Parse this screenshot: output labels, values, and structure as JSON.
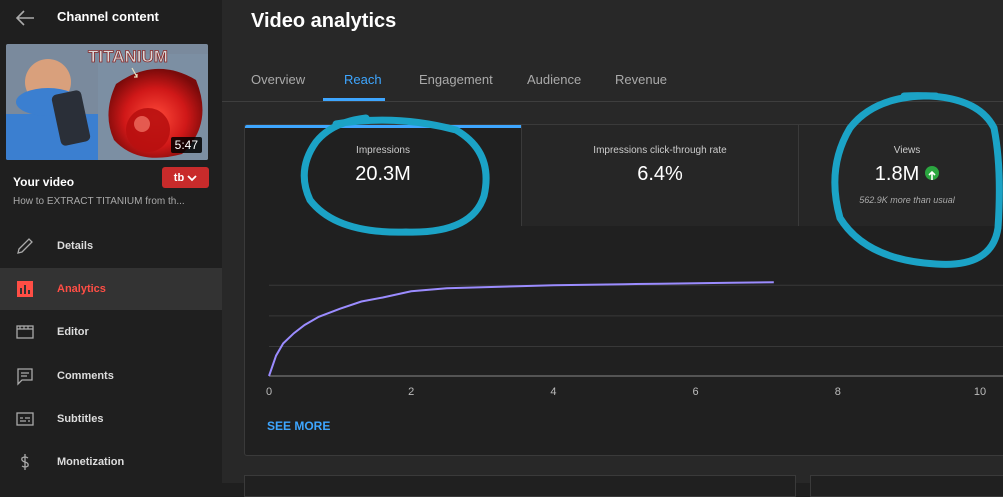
{
  "sidebar": {
    "title": "Channel content",
    "thumbnail": {
      "overlay_text": "TITANIUM",
      "duration": "5:47"
    },
    "your_video_label": "Your video",
    "badge": "tb",
    "video_title": "How to EXTRACT TITANIUM from th...",
    "nav": [
      {
        "label": "Details",
        "icon": "pencil-icon"
      },
      {
        "label": "Analytics",
        "icon": "analytics-icon"
      },
      {
        "label": "Editor",
        "icon": "editor-icon"
      },
      {
        "label": "Comments",
        "icon": "comments-icon"
      },
      {
        "label": "Subtitles",
        "icon": "subtitles-icon"
      },
      {
        "label": "Monetization",
        "icon": "dollar-icon"
      }
    ]
  },
  "main": {
    "title": "Video analytics",
    "tabs": [
      "Overview",
      "Reach",
      "Engagement",
      "Audience",
      "Revenue"
    ],
    "active_tab": "Reach",
    "metrics": [
      {
        "label": "Impressions",
        "value": "20.3M"
      },
      {
        "label": "Impressions click-through rate",
        "value": "6.4%"
      },
      {
        "label": "Views",
        "value": "1.8M",
        "sub": "562.9K more than usual"
      }
    ],
    "see_more": "SEE MORE"
  },
  "colors": {
    "accent": "#3ea6ff",
    "active_nav": "#ff4e45",
    "line": "#9b8cff",
    "circle": "#1ba3c6",
    "positive": "#2ba640"
  },
  "chart_data": {
    "type": "line",
    "x_ticks": [
      "0",
      "2",
      "4",
      "6",
      "8",
      "10"
    ],
    "xlim": [
      0,
      10
    ],
    "ylim": [
      0,
      1
    ],
    "x": [
      0,
      0.1,
      0.2,
      0.35,
      0.5,
      0.7,
      1.0,
      1.3,
      1.6,
      2.0,
      2.5,
      3.0,
      3.5,
      4.0,
      4.5,
      5.0,
      5.5,
      6.0,
      6.5,
      7.1
    ],
    "y": [
      0,
      0.2,
      0.32,
      0.42,
      0.5,
      0.58,
      0.66,
      0.73,
      0.77,
      0.83,
      0.86,
      0.87,
      0.88,
      0.89,
      0.895,
      0.9,
      0.905,
      0.91,
      0.915,
      0.92
    ]
  }
}
